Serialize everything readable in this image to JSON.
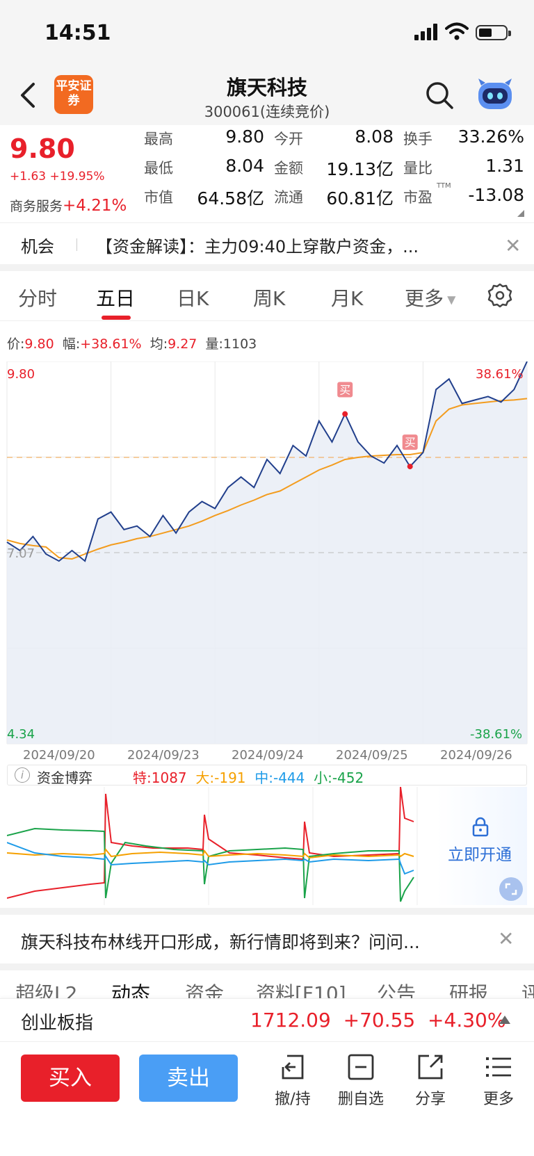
{
  "status": {
    "time": "14:51"
  },
  "nav": {
    "logo": "平安证券",
    "name": "旗天科技",
    "code": "300061(连续竞价)"
  },
  "quote": {
    "price": "9.80",
    "change": "+1.63 +19.95%",
    "sector_label": "商务服务",
    "sector_change": "+4.21%",
    "rows": [
      {
        "l1": "最高",
        "v1": "9.80",
        "l2": "今开",
        "v2": "8.08",
        "l3": "换手",
        "v3": "33.26%"
      },
      {
        "l1": "最低",
        "v1": "8.04",
        "l2": "金额",
        "v2": "19.13亿",
        "l3": "量比",
        "v3": "1.31"
      },
      {
        "l1": "市值",
        "v1": "64.58亿",
        "l2": "流通",
        "v2": "60.81亿",
        "l3": "市盈",
        "v3": "-13.08"
      }
    ],
    "pe_sup": "TTM"
  },
  "ticker": {
    "tag": "机会",
    "text": "【资金解读】：主力09:40上穿散户资金，..."
  },
  "tabs": [
    "分时",
    "五日",
    "日K",
    "周K",
    "月K",
    "更多"
  ],
  "info": {
    "price_label": "价:",
    "price": "9.80",
    "amp_label": "幅:",
    "amp": "+38.61%",
    "avg_label": "均:",
    "avg": "9.27",
    "vol_label": "量:",
    "vol": "1103"
  },
  "chart_data": {
    "type": "line",
    "title": "",
    "ylim": [
      4.34,
      9.8
    ],
    "y_labels": {
      "top": "9.80",
      "mid": "7.07",
      "bottom": "4.34",
      "top_pct": "38.61%",
      "bottom_pct": "-38.61%"
    },
    "x": [
      "2024/09/20",
      "2024/09/23",
      "2024/09/24",
      "2024/09/25",
      "2024/09/26"
    ],
    "buy_marker": "买",
    "ref_price": 8.43,
    "series": [
      {
        "values": [
          7.22,
          7.1,
          7.3,
          7.05,
          6.95,
          7.1,
          6.95,
          7.55,
          7.65,
          7.4,
          7.45,
          7.3,
          7.6,
          7.35,
          7.65,
          7.8,
          7.7,
          8.0,
          8.15,
          8.0,
          8.4,
          8.2,
          8.6,
          8.45,
          8.95,
          8.65,
          9.05,
          8.65,
          8.45,
          8.35,
          8.6,
          8.3,
          8.5,
          9.4,
          9.55,
          9.2,
          9.25,
          9.3,
          9.22,
          9.4,
          9.8
        ]
      },
      {
        "values": [
          7.25,
          7.2,
          7.17,
          7.15,
          7.0,
          6.98,
          7.05,
          7.12,
          7.18,
          7.22,
          7.27,
          7.3,
          7.35,
          7.4,
          7.45,
          7.52,
          7.6,
          7.67,
          7.75,
          7.82,
          7.9,
          7.95,
          8.05,
          8.15,
          8.25,
          8.32,
          8.4,
          8.43,
          8.45,
          8.46,
          8.47,
          8.47,
          8.5,
          8.95,
          9.12,
          9.18,
          9.2,
          9.22,
          9.24,
          9.25,
          9.27
        ]
      }
    ]
  },
  "flow": {
    "title": "资金博弈",
    "te_label": "特:",
    "te": "1087",
    "da_label": "大:",
    "da": "-191",
    "zhong_label": "中:",
    "zhong": "-444",
    "xiao_label": "小:",
    "xiao": "-452",
    "unlock": "立即开通"
  },
  "promo": {
    "text": "旗天科技布林线开口形成，新行情即将到来？问问..."
  },
  "subtabs": [
    "超级L2",
    "动态",
    "资金",
    "资料[F10]",
    "公告",
    "研报",
    "评"
  ],
  "index": {
    "name": "创业板指",
    "value": "1712.09",
    "change": "+70.55",
    "pct": "+4.30%"
  },
  "actions": {
    "buy": "买入",
    "sell": "卖出",
    "items": [
      {
        "icon": "withdraw-icon",
        "label": "撤/持"
      },
      {
        "icon": "remove-watchlist-icon",
        "label": "删自选"
      },
      {
        "icon": "share-icon",
        "label": "分享"
      },
      {
        "icon": "more-menu-icon",
        "label": "更多"
      }
    ]
  },
  "colors": {
    "up": "#e8202a",
    "down": "#1aa34a",
    "price_line": "#213f8c",
    "avg_line": "#f39c1e",
    "accent": "#4a9ef5"
  }
}
